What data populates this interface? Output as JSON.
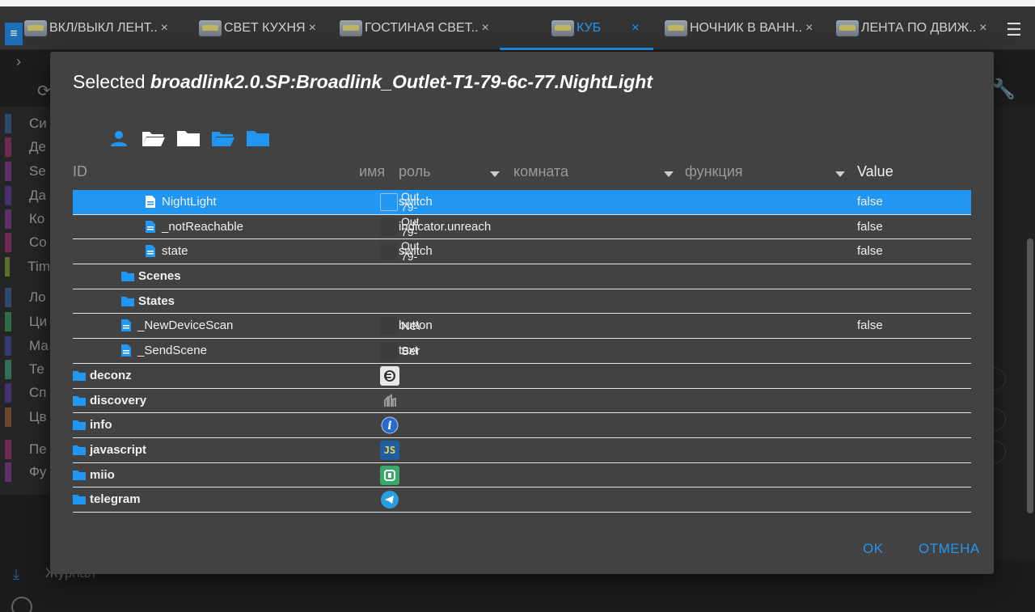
{
  "tabs": [
    {
      "label": "ВКЛ/ВЫКЛ ЛЕНТ..",
      "close": "×",
      "active": false
    },
    {
      "label": "СВЕТ КУХНЯ",
      "close": "×",
      "active": false
    },
    {
      "label": "ГОСТИНАЯ СВЕТ..",
      "close": "×",
      "active": false
    },
    {
      "label": "КУБ",
      "close": "×",
      "active": true
    },
    {
      "label": "НОЧНИК В ВАНН..",
      "close": "×",
      "active": false
    },
    {
      "label": "ЛЕНТА ПО ДВИЖ..",
      "close": "×",
      "active": false
    }
  ],
  "background": {
    "sidebar_items": [
      {
        "label": "Си",
        "color": "#4a6fa5"
      },
      {
        "label": "Де",
        "color": "#a8437a"
      },
      {
        "label": "Se",
        "color": "#8e4aa8"
      },
      {
        "label": "Да",
        "color": "#6a4aa8"
      },
      {
        "label": "Ко",
        "color": "#8e4aa8"
      },
      {
        "label": "Co",
        "color": "#a8437a"
      },
      {
        "label": "Tim",
        "color": "#8ea84a"
      },
      {
        "label": "Ло",
        "color": "#4a6fa5"
      },
      {
        "label": "Ци",
        "color": "#4aa86a"
      },
      {
        "label": "Ма",
        "color": "#4a5fa8"
      },
      {
        "label": "Те",
        "color": "#4aa890"
      },
      {
        "label": "Сп",
        "color": "#6a4aa8"
      },
      {
        "label": "Цв",
        "color": "#a86a4a"
      },
      {
        "label": "Пе",
        "color": "#a8437a"
      },
      {
        "label": "Фу",
        "color": "#8e4aa8"
      }
    ],
    "journal_label": "Журнал"
  },
  "dialog": {
    "title_prefix": "Selected",
    "title_id": "broadlink2.0.SP:Broadlink_Outlet-T1-79-6c-77.NightLight",
    "columns": {
      "id": "ID",
      "name": "имя",
      "role": "роль",
      "room": "комната",
      "function": "функция",
      "value": "Value"
    },
    "rows": [
      {
        "id": "NightLight",
        "type": "state",
        "name_line1": "Out",
        "name_line2": "79-",
        "role": "switch",
        "value": "false",
        "selected": true
      },
      {
        "id": "_notReachable",
        "type": "state",
        "name_line1": "Out",
        "name_line2": "79-",
        "role": "indicator.unreach",
        "value": "false",
        "selected": false
      },
      {
        "id": "state",
        "type": "state",
        "name_line1": "Out",
        "name_line2": "79-",
        "role": "switch",
        "value": "false",
        "selected": false
      },
      {
        "id": "Scenes",
        "type": "folder",
        "selected": false
      },
      {
        "id": "States",
        "type": "folder",
        "selected": false
      },
      {
        "id": "_NewDeviceScan",
        "type": "state",
        "name": "Ne\\",
        "role": "button",
        "value": "false",
        "selected": false
      },
      {
        "id": "_SendScene",
        "type": "state",
        "name": "Ser",
        "role": "text",
        "value": "",
        "selected": false
      },
      {
        "id": "deconz",
        "type": "adapter",
        "icon": "deconz-icon"
      },
      {
        "id": "discovery",
        "type": "adapter",
        "icon": "discovery-icon"
      },
      {
        "id": "info",
        "type": "adapter",
        "icon": "info-icon"
      },
      {
        "id": "javascript",
        "type": "adapter",
        "icon": "javascript-icon",
        "icon_text": "JS"
      },
      {
        "id": "miio",
        "type": "adapter",
        "icon": "miio-icon"
      },
      {
        "id": "telegram",
        "type": "adapter",
        "icon": "telegram-icon"
      }
    ],
    "ok_label": "OK",
    "cancel_label": "ОТМЕНА"
  },
  "colors": {
    "accent": "#2196f3",
    "dialog_bg": "#424242"
  }
}
